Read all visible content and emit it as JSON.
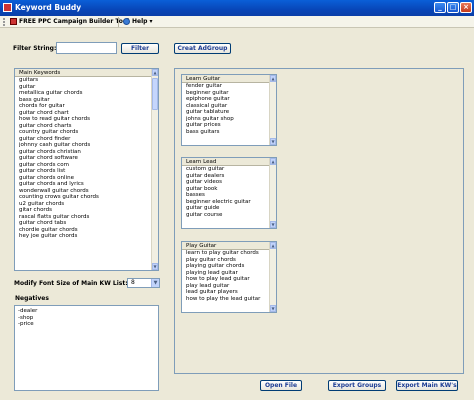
{
  "window": {
    "title": "Keyword Buddy",
    "minimize": "_",
    "maximize": "□",
    "close": "×"
  },
  "toolbar": {
    "app_label": "FREE PPC Campaign Builder Tool",
    "help_label": "Help",
    "help_arrow": "▾"
  },
  "filter": {
    "label": "Filter String:",
    "value": "",
    "filter_button": "Filter",
    "create_button": "Creat AdGroup"
  },
  "main_keywords": {
    "header": "Main Keywords",
    "items": [
      "guitars",
      "guitar",
      "metallica guitar chords",
      "bass guitar",
      "chords for guitar",
      "guitar chord chart",
      "how to read guitar chords",
      "guitar chord charts",
      "country guitar chords",
      "guitar chord finder",
      "johnny cash guitar chords",
      "guitar chords christian",
      "guitar chord software",
      "guitar chords com",
      "guitar chords list",
      "guitar chords online",
      "guitar chords and lyrics",
      "wonderwall guitar chords",
      "counting crows guitar chords",
      "u2 guitar chords",
      "gitar chords",
      "rascal flatts guitar chords",
      "guitar chord tabs",
      "chordie guitar chords",
      "hey joe guitar chords"
    ]
  },
  "font_size": {
    "label": "Modify Font Size of Main KW List:",
    "value": "8"
  },
  "negatives": {
    "label": "Negatives",
    "items": [
      "-dealer",
      "-shop",
      "-price"
    ]
  },
  "groups": [
    {
      "header": "Learn Guitar",
      "items": [
        "fender guitar",
        "beginner guitar",
        "epiphone guitar",
        "classical guitar",
        "guitar tablature",
        "johns guitar shop",
        "guitar prices",
        "bass guitars"
      ]
    },
    {
      "header": "Learn Lead",
      "items": [
        "custom guitar",
        "guitar dealers",
        "guitar videos",
        "guitar book",
        "basses",
        "beginner electric guitar",
        "guitar guide",
        "guitar course"
      ]
    },
    {
      "header": "Play Guitar",
      "items": [
        "learn to play guitar chords",
        "play guitar chords",
        "playing guitar chords",
        "playing lead guitar",
        "how to play lead guitar",
        "play lead guitar",
        "lead guitar players",
        "how to play the lead guitar"
      ]
    }
  ],
  "bottom_buttons": {
    "open_file": "Open File",
    "export_groups": "Export Groups",
    "export_main": "Export Main KW's"
  }
}
